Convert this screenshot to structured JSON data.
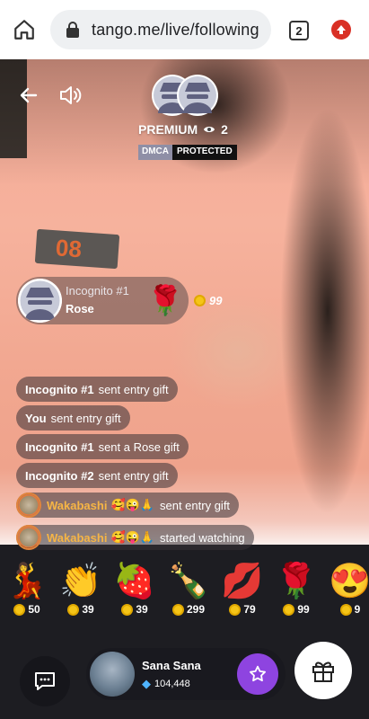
{
  "browser": {
    "url": "tango.me/live/following",
    "tab_count": "2"
  },
  "stream": {
    "host_label": "PREMIUM",
    "viewers": "2",
    "badge_left": "DMCA",
    "badge_right": "PROTECTED",
    "gift_card": {
      "sender": "Incognito #1",
      "item": "Rose",
      "emoji": "🌹",
      "coins": "99"
    },
    "chat": [
      {
        "user": "Incognito #1",
        "text": "sent entry gift"
      },
      {
        "user": "You",
        "text": "sent entry gift"
      },
      {
        "user": "Incognito #1",
        "text": "sent a Rose gift"
      },
      {
        "user": "Incognito #2",
        "text": "sent entry gift"
      },
      {
        "user": "Wakabashi",
        "emojis": "🥰😜🙏",
        "text": "sent entry gift"
      },
      {
        "user": "Wakabashi",
        "emojis": "🥰😜🙏",
        "text": "started watching"
      }
    ],
    "gifts": [
      {
        "emoji": "💃",
        "price": "50"
      },
      {
        "emoji": "👏",
        "price": "39"
      },
      {
        "emoji": "🍓",
        "price": "39"
      },
      {
        "emoji": "🍾",
        "price": "299"
      },
      {
        "emoji": "💋",
        "price": "79"
      },
      {
        "emoji": "🌹",
        "price": "99"
      },
      {
        "emoji": "😍",
        "price": "9"
      }
    ],
    "host": {
      "name": "Sana Sana",
      "diamonds": "104,448"
    }
  },
  "colors": {
    "accent": "#8e44e0",
    "coin": "#f5c518",
    "highlight_name": "#f6b545"
  }
}
